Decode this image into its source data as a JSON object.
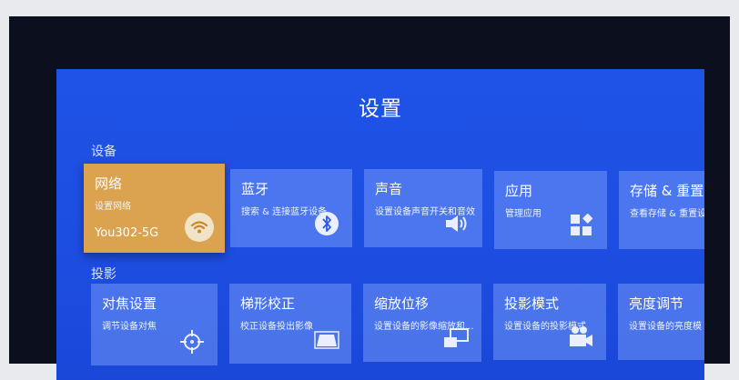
{
  "screen": {
    "title": "设置"
  },
  "sections": {
    "device": "设备",
    "projection": "投影"
  },
  "device_cards": [
    {
      "title": "网络",
      "subtitle": "设置网络",
      "value": "You302-5G",
      "icon": "wifi-icon",
      "selected": true
    },
    {
      "title": "蓝牙",
      "subtitle": "搜索 & 连接蓝牙设备",
      "icon": "bluetooth-icon"
    },
    {
      "title": "声音",
      "subtitle": "设置设备声音开关和音效",
      "icon": "speaker-icon"
    },
    {
      "title": "应用",
      "subtitle": "管理应用",
      "icon": "apps-icon"
    },
    {
      "title": "存储 & 重置",
      "subtitle": "查看存储 & 重置设",
      "icon": "storage-icon"
    }
  ],
  "projection_cards": [
    {
      "title": "对焦设置",
      "subtitle": "调节设备对焦",
      "icon": "focus-crosshair-icon"
    },
    {
      "title": "梯形校正",
      "subtitle": "校正设备投出影像",
      "icon": "keystone-icon"
    },
    {
      "title": "缩放位移",
      "subtitle": "设置设备的影像缩放和...",
      "icon": "zoom-shift-icon"
    },
    {
      "title": "投影模式",
      "subtitle": "设置设备的投影模式",
      "icon": "projector-icon"
    },
    {
      "title": "亮度调节",
      "subtitle": "设置设备的亮度模",
      "icon": "brightness-icon"
    }
  ],
  "colors": {
    "screen_bg": "#1f52e6",
    "card_bg": "#6f93f5",
    "selected_bg": "#dba24f"
  }
}
